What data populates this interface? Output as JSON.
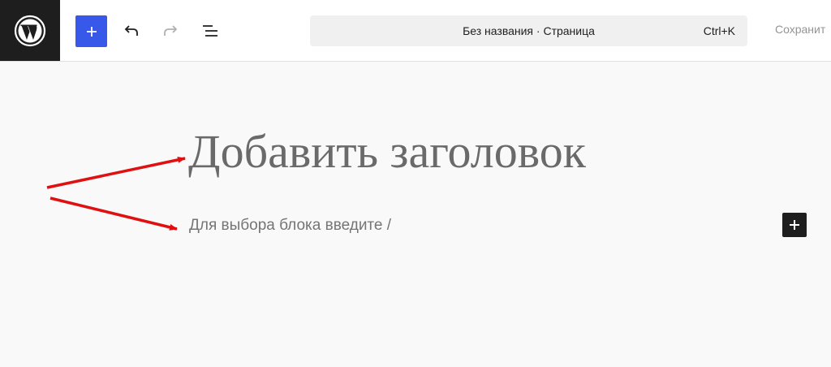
{
  "header": {
    "logo_icon": "wordpress-logo-icon",
    "add_block_icon": "plus-icon",
    "undo_icon": "undo-icon",
    "redo_icon": "redo-icon",
    "list_view_icon": "list-view-icon",
    "document_title": "Без названия · Страница",
    "command_shortcut": "Ctrl+K",
    "save_label": "Сохранит"
  },
  "editor": {
    "title_placeholder": "Добавить заголовок",
    "paragraph_placeholder": "Для выбора блока введите /",
    "inserter_icon": "plus-icon"
  },
  "annotation": {
    "arrow_color": "#e01010"
  },
  "colors": {
    "accent": "#3858e9",
    "logo_bg": "#1e1e1e"
  }
}
